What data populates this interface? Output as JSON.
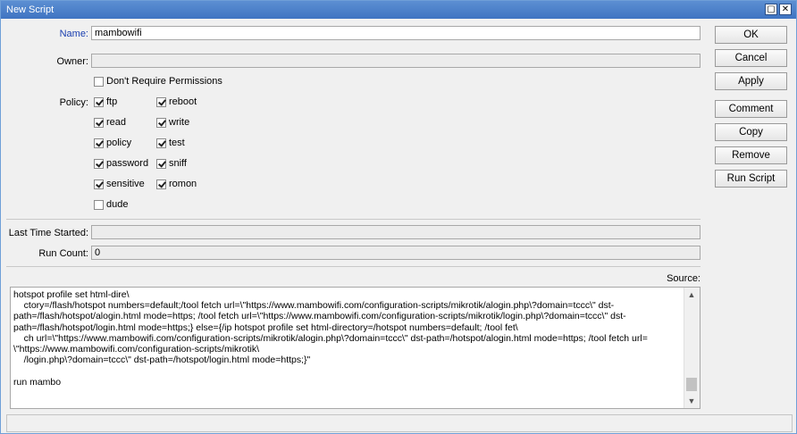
{
  "window": {
    "title": "New Script"
  },
  "form": {
    "name_label": "Name:",
    "name_value": "mambowifi",
    "owner_label": "Owner:",
    "owner_value": "",
    "dont_require_label": "Don't Require Permissions",
    "dont_require_checked": false,
    "policy_label": "Policy:",
    "policies": [
      {
        "label": "ftp",
        "checked": true
      },
      {
        "label": "reboot",
        "checked": true
      },
      {
        "label": "read",
        "checked": true
      },
      {
        "label": "write",
        "checked": true
      },
      {
        "label": "policy",
        "checked": true
      },
      {
        "label": "test",
        "checked": true
      },
      {
        "label": "password",
        "checked": true
      },
      {
        "label": "sniff",
        "checked": true
      },
      {
        "label": "sensitive",
        "checked": true
      },
      {
        "label": "romon",
        "checked": true
      },
      {
        "label": "dude",
        "checked": false
      }
    ],
    "last_started_label": "Last Time Started:",
    "last_started_value": "",
    "run_count_label": "Run Count:",
    "run_count_value": "0",
    "source_label": "Source:"
  },
  "source_lines": [
    "hotspot profile set html-dire\\",
    "    ctory=/flash/hotspot numbers=default;/tool fetch url=\\\"https://www.mambowifi.com/configuration-scripts/mikrotik/alogin.php\\?domain=tccc\\\" dst-",
    "path=/flash/hotspot/alogin.html mode=https; /tool fetch url=\\\"https://www.mambowifi.com/configuration-scripts/mikrotik/login.php\\?domain=tccc\\\" dst-",
    "path=/flash/hotspot/login.html mode=https;} else={/ip hotspot profile set html-directory=/hotspot numbers=default; /tool fet\\",
    "    ch url=\\\"https://www.mambowifi.com/configuration-scripts/mikrotik/alogin.php\\?domain=tccc\\\" dst-path=/hotspot/alogin.html mode=https; /tool fetch url=",
    "\\\"https://www.mambowifi.com/configuration-scripts/mikrotik\\",
    "    /login.php\\?domain=tccc\\\" dst-path=/hotspot/login.html mode=https;}\"",
    "",
    "run mambo"
  ],
  "buttons": {
    "ok": "OK",
    "cancel": "Cancel",
    "apply": "Apply",
    "comment": "Comment",
    "copy": "Copy",
    "remove": "Remove",
    "run_script": "Run Script"
  },
  "titlebar_buttons": {
    "maximize": "▢",
    "close": "✕"
  },
  "status": ""
}
